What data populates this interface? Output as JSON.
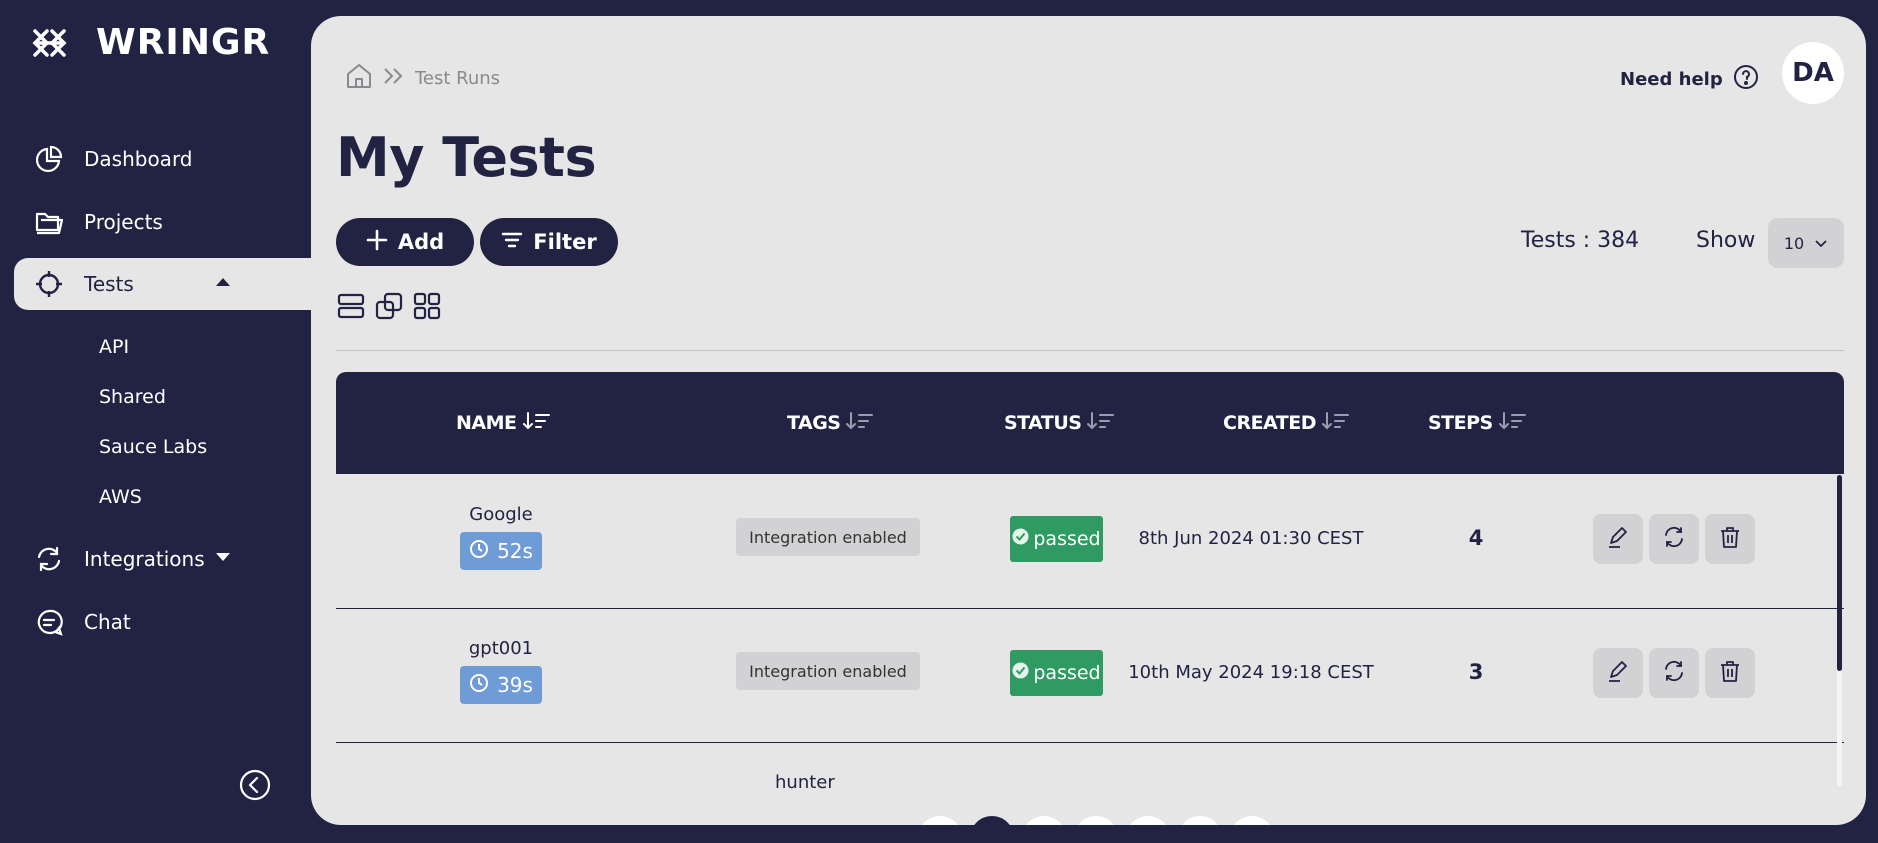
{
  "app": {
    "brand": "WRINGR"
  },
  "sidebar": {
    "items": [
      {
        "label": "Dashboard",
        "icon": "pie-chart-icon"
      },
      {
        "label": "Projects",
        "icon": "folders-icon"
      },
      {
        "label": "Tests",
        "icon": "crosshair-icon",
        "active": true,
        "expanded": true
      },
      {
        "label": "Integrations",
        "icon": "refresh-icon"
      },
      {
        "label": "Chat",
        "icon": "chat-icon"
      }
    ],
    "sub_items": [
      "API",
      "Shared",
      "Sauce Labs",
      "AWS"
    ]
  },
  "breadcrumb": {
    "current": "Test Runs"
  },
  "header": {
    "help_label": "Need help",
    "avatar_initials": "DA"
  },
  "page": {
    "title": "My Tests"
  },
  "toolbar": {
    "add_label": "Add",
    "filter_label": "Filter",
    "tests_count": "Tests : 384",
    "show_label": "Show",
    "show_value": "10"
  },
  "table": {
    "columns": [
      "NAME",
      "TAGS",
      "STATUS",
      "CREATED",
      "STEPS"
    ],
    "rows": [
      {
        "name": "Google",
        "duration": "52s",
        "tag": "Integration enabled",
        "status": "passed",
        "created": "8th Jun 2024 01:30 CEST",
        "steps": "4"
      },
      {
        "name": "gpt001",
        "duration": "39s",
        "tag": "Integration enabled",
        "status": "passed",
        "created": "10th May 2024 19:18 CEST",
        "steps": "3"
      }
    ],
    "partial_row_name": "hunter"
  },
  "colors": {
    "navy": "#222343",
    "panel": "#e6e6e6",
    "passed": "#2f9b63",
    "duration": "#6f9bd6"
  }
}
